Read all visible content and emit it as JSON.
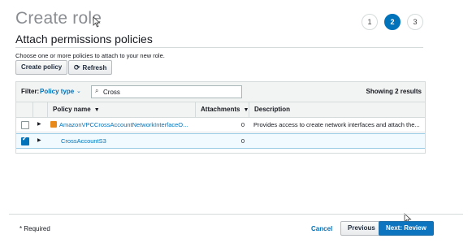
{
  "header": {
    "title": "Create role",
    "steps": [
      {
        "label": "1",
        "active": false
      },
      {
        "label": "2",
        "active": true
      },
      {
        "label": "3",
        "active": false
      }
    ]
  },
  "section": {
    "title": "Attach permissions policies",
    "hint": "Choose one or more policies to attach to your new role."
  },
  "toolbar": {
    "create_label": "Create policy",
    "refresh_label": "Refresh",
    "refresh_icon": "refresh-icon"
  },
  "filter": {
    "label": "Filter:",
    "type": "Policy type",
    "search_value": "Cross",
    "search_icon": "search-icon",
    "showing": "Showing 2 results"
  },
  "table": {
    "columns": [
      "Policy name",
      "Attachments",
      "Description"
    ],
    "rows": [
      {
        "checked": false,
        "name": "AmazonVPCCrossAccountNetworkInterfaceO...",
        "aws_managed_icon": "aws-managed-policy-icon",
        "attachments": "0",
        "description": "Provides access to create network interfaces and attach the..."
      },
      {
        "checked": true,
        "name": "CrossAccountS3",
        "attachments": "0",
        "description": ""
      }
    ]
  },
  "footer": {
    "required": "* Required",
    "cancel": "Cancel",
    "previous": "Previous",
    "next": "Next: Review"
  },
  "colors": {
    "accent": "#0073bb",
    "primary_button": "#0d74c0",
    "selected_row": "#f1faff"
  }
}
